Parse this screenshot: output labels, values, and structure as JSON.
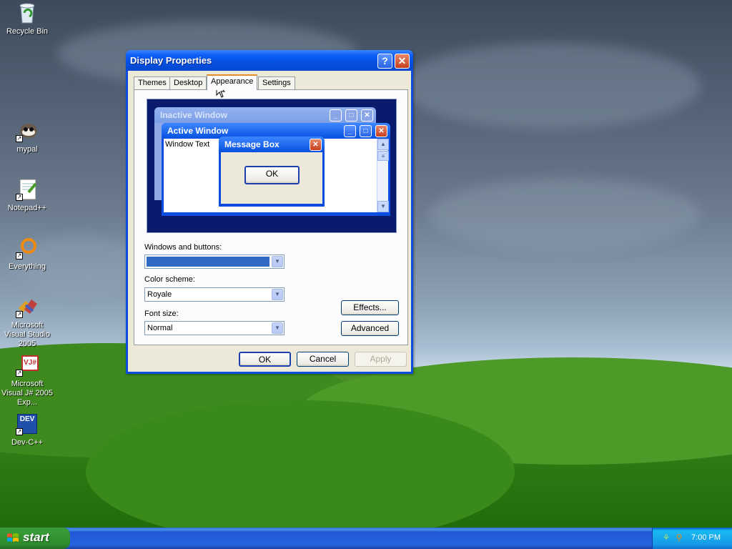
{
  "desktop": {
    "icons": [
      {
        "label": "Recycle Bin",
        "icon": "recycle-bin-icon"
      },
      {
        "label": "mypal",
        "icon": "mypal-icon"
      },
      {
        "label": "Notepad++",
        "icon": "notepad-plus-plus-icon"
      },
      {
        "label": "Everything",
        "icon": "everything-search-icon"
      },
      {
        "label": "Microsoft Visual Studio 2005",
        "icon": "visual-studio-icon"
      },
      {
        "label": "Microsoft Visual J# 2005 Exp...",
        "icon": "visual-jsharp-icon",
        "glyph": "VJ#"
      },
      {
        "label": "Dev-C++",
        "icon": "dev-cpp-icon",
        "glyph": "DEV"
      }
    ]
  },
  "dialog": {
    "title": "Display Properties",
    "help_glyph": "?",
    "close_glyph": "✕",
    "tabs": [
      {
        "label": "Themes"
      },
      {
        "label": "Desktop"
      },
      {
        "label": "Appearance",
        "active": true
      },
      {
        "label": "Settings"
      }
    ],
    "preview": {
      "inactive_title": "Inactive Window",
      "active_title": "Active Window",
      "window_text": "Window Text",
      "message_box_title": "Message Box",
      "message_box_ok": "OK",
      "min_glyph": "_",
      "max_glyph": "□",
      "close_glyph": "✕"
    },
    "windows_buttons_label": "Windows and buttons:",
    "color_scheme_label": "Color scheme:",
    "color_scheme_value": "Royale",
    "font_size_label": "Font size:",
    "font_size_value": "Normal",
    "effects_label": "Effects...",
    "advanced_label": "Advanced",
    "ok_label": "OK",
    "cancel_label": "Cancel",
    "apply_label": "Apply",
    "dropdown_glyph": "▼"
  },
  "taskbar": {
    "start_label": "start",
    "clock": "7:00 PM"
  },
  "colors": {
    "title_blue": "#0650e0",
    "selection_blue": "#316ac5",
    "tab_highlight": "#e68b2c"
  }
}
